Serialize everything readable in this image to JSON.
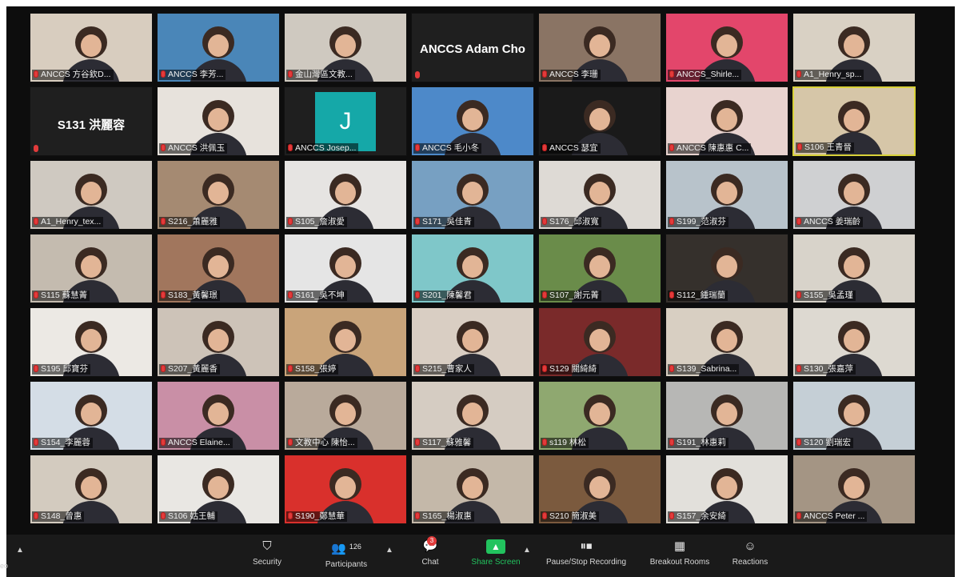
{
  "tiles": [
    {
      "name": "ANCCS 方谷欽D...",
      "bg": "#d8cdbf"
    },
    {
      "name": "ANCCS 李芳...",
      "bg": "#4a86b8"
    },
    {
      "name": "金山灣區文教...",
      "bg": "#cfc9c0"
    },
    {
      "name": "ANCCS Adam Cho",
      "bg": "#1f1f1f",
      "big": "ANCCS Adam Cho",
      "type": "text"
    },
    {
      "name": "ANCCS 李珊",
      "bg": "#8a7464"
    },
    {
      "name": "ANCCS_Shirle...",
      "bg": "#e3466b"
    },
    {
      "name": "A1_Henry_sp...",
      "bg": "#d9d1c4"
    },
    {
      "name": "S131 洪麗容",
      "bg": "#1f1f1f",
      "big": "S131 洪麗容",
      "type": "text"
    },
    {
      "name": "ANCCS 洪佩玉",
      "bg": "#e7e2dc"
    },
    {
      "name": "ANCCS Josep...",
      "bg": "#1f1f1f",
      "type": "initial",
      "initial": "J"
    },
    {
      "name": "ANCCS 毛小冬",
      "bg": "#4d89c9"
    },
    {
      "name": "ANCCS 瑟宜",
      "bg": "#1a1a1a"
    },
    {
      "name": "ANCCS 陳惠惠 C...",
      "bg": "#e8d3cf"
    },
    {
      "name": "S106 王青晉",
      "bg": "#d6c6a8",
      "active": true
    },
    {
      "name": "A1_Henry_tex...",
      "bg": "#cfc9c1"
    },
    {
      "name": "S216_蕭麗雅",
      "bg": "#a58a72"
    },
    {
      "name": "S105_詹淑愛",
      "bg": "#e6e4e2"
    },
    {
      "name": "S171_吳佳青",
      "bg": "#77a0c2"
    },
    {
      "name": "S176_邱淑寬",
      "bg": "#dedad5"
    },
    {
      "name": "S199_范淑芬",
      "bg": "#b8c3cb"
    },
    {
      "name": "ANCCS 姜瑞齡",
      "bg": "#cfd0d2"
    },
    {
      "name": "S115 蘇慧菁",
      "bg": "#c4bbaf"
    },
    {
      "name": "S183_黃馨璟",
      "bg": "#a1765d"
    },
    {
      "name": "S161_吳不坤",
      "bg": "#e5e5e5"
    },
    {
      "name": "S201_陳馨君",
      "bg": "#7fc7c9"
    },
    {
      "name": "S107_謝元菁",
      "bg": "#6a8c4a"
    },
    {
      "name": "S112_鍾瑞蘭",
      "bg": "#35302c"
    },
    {
      "name": "S155_吳孟瑾",
      "bg": "#d8d3ca"
    },
    {
      "name": "S195 邱寶芬",
      "bg": "#ece9e4"
    },
    {
      "name": "S207_黃麗香",
      "bg": "#cdc3b8"
    },
    {
      "name": "S158_張婷",
      "bg": "#c9a47a"
    },
    {
      "name": "S215_曹家人",
      "bg": "#d9cec3"
    },
    {
      "name": "S129 關綺綺",
      "bg": "#7a2a2a"
    },
    {
      "name": "S139_Sabrina...",
      "bg": "#d8cfc2"
    },
    {
      "name": "S130_張嘉萍",
      "bg": "#ddd9d1"
    },
    {
      "name": "S154_李麗蓉",
      "bg": "#d4dde6"
    },
    {
      "name": "ANCCS Elaine...",
      "bg": "#c98fa6"
    },
    {
      "name": "文教中心 陳怡...",
      "bg": "#b9aa9b"
    },
    {
      "name": "S117_蘇雅馨",
      "bg": "#d5ccc2"
    },
    {
      "name": "s119 林松",
      "bg": "#8fa870"
    },
    {
      "name": "S191_林惠莉",
      "bg": "#b7b7b5"
    },
    {
      "name": "S120 劉瑞宏",
      "bg": "#c5cfd6"
    },
    {
      "name": "S148_曾惠",
      "bg": "#d3cbbf"
    },
    {
      "name": "S106 姑王輔",
      "bg": "#e9e7e3"
    },
    {
      "name": "S190_鄭慧華",
      "bg": "#d9302c"
    },
    {
      "name": "S165_楊淑惠",
      "bg": "#c4b8a9"
    },
    {
      "name": "S210 簡淑美",
      "bg": "#7b5a3e"
    },
    {
      "name": "S157_余安綺",
      "bg": "#e2e0db"
    },
    {
      "name": "ANCCS Peter ...",
      "bg": "#a49584"
    }
  ],
  "toolbar": {
    "left_edge": "eo",
    "security": "Security",
    "participants": "Participants",
    "participants_count": "126",
    "chat": "Chat",
    "chat_badge": "3",
    "share": "Share Screen",
    "record": "Pause/Stop Recording",
    "breakout": "Breakout Rooms",
    "reactions": "Reactions"
  },
  "icons": {
    "security": "shield-icon",
    "participants": "people-icon",
    "chat": "chat-bubble-icon",
    "share": "share-screen-arrow-icon",
    "record": "pause-stop-icon",
    "breakout": "grid-squares-icon",
    "reactions": "smiley-icon",
    "mic": "mic-muted-icon"
  },
  "colors": {
    "active_speaker_border": "#d9d23a",
    "share_green": "#22c35e",
    "muted_red": "#e23b3b"
  }
}
